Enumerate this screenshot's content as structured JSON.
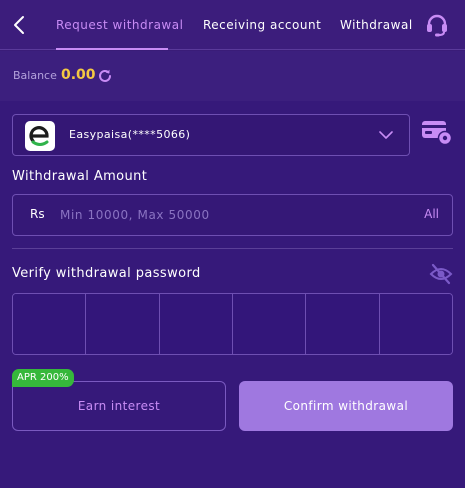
{
  "header": {
    "tabs": [
      {
        "label": "Request withdrawal",
        "active": true
      },
      {
        "label": "Receiving account",
        "active": false
      },
      {
        "label": "Withdrawal",
        "active": false
      }
    ]
  },
  "balance": {
    "label": "Balance",
    "value": "0.00"
  },
  "account": {
    "name": "Easypaisa(****5066)"
  },
  "amount": {
    "title": "Withdrawal Amount",
    "currency": "Rs",
    "placeholder": "Min 10000, Max 50000",
    "all_label": "All"
  },
  "password": {
    "title": "Verify withdrawal password",
    "cell_count": 6
  },
  "actions": {
    "apr_badge": "APR 200%",
    "earn_label": "Earn interest",
    "confirm_label": "Confirm withdrawal"
  },
  "colors": {
    "accent": "#c88cf5",
    "balance": "#f4c842",
    "confirm_bg": "#9f78e0",
    "badge_bg": "#36b83b"
  }
}
